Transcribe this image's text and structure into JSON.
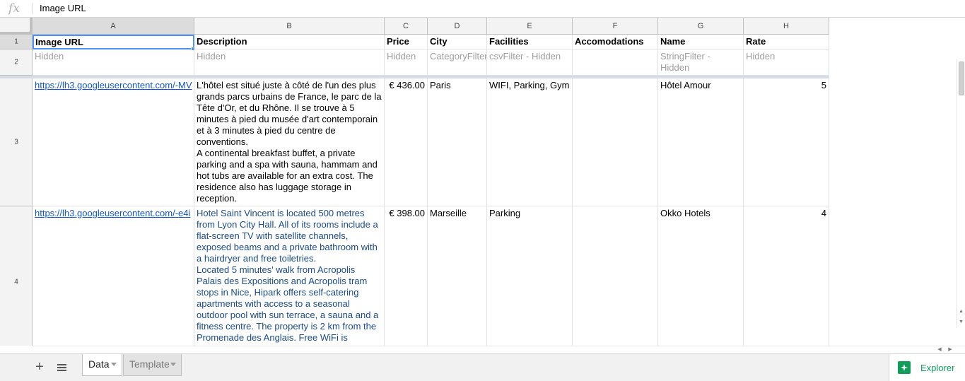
{
  "formula_bar": {
    "fx_label": "fx",
    "value": "Image URL"
  },
  "columns": [
    "A",
    "B",
    "C",
    "D",
    "E",
    "F",
    "G",
    "H"
  ],
  "rows": [
    "1",
    "2",
    "3",
    "4"
  ],
  "header_row": [
    "Image URL",
    "Description",
    "Price",
    "City",
    "Facilities",
    "Accomodations",
    "Name",
    "Rate"
  ],
  "filter_row": [
    "Hidden",
    "Hidden",
    "Hidden",
    "CategoryFilter",
    "csvFilter - Hidden",
    "",
    "StringFilter - Hidden",
    "Hidden"
  ],
  "data_rows": [
    {
      "image_url": "https://lh3.googleusercontent.com/-MV",
      "description": "L'hôtel est situé juste à côté de l'un des plus grands parcs urbains de France, le parc de la Tête d'Or, et du Rhône. Il se trouve à 5 minutes à pied du musée d'art contemporain et à 3 minutes à pied du centre de conventions.\nA continental breakfast buffet, a private parking and a spa with sauna, hammam and hot tubs are available for an extra cost. The residence also has luggage storage in reception.",
      "price": "€ 436.00",
      "city": "Paris",
      "facilities": "WIFI, Parking, Gym",
      "accomodations": "",
      "name": "Hôtel Amour",
      "rate": "5"
    },
    {
      "image_url": "https://lh3.googleusercontent.com/-e4i",
      "description": "Hotel Saint Vincent is located 500 metres from Lyon City Hall. All of its rooms include a flat-screen TV with satellite channels, exposed beams and a private bathroom with a hairdryer and free toiletries.\nLocated 5 minutes' walk from Acropolis Palais des Expositions and Acropolis tram stops in Nice, Hipark offers self-catering apartments with access to a seasonal outdoor pool with sun terrace, a sauna and a fitness centre. The property is 2 km from the Promenade des Anglais. Free WiFi is",
      "price": "€ 398.00",
      "city": "Marseille",
      "facilities": "Parking",
      "accomodations": "",
      "name": "Okko Hotels",
      "rate": "4"
    }
  ],
  "sheet_bar": {
    "add_label": "+",
    "tabs": [
      {
        "label": "Data",
        "active": true
      },
      {
        "label": "Template",
        "active": false
      }
    ],
    "explorer_label": "Explorer"
  },
  "scroll_arrows": {
    "up": "▲",
    "down": "▼",
    "left": "◀",
    "right": "▶"
  }
}
